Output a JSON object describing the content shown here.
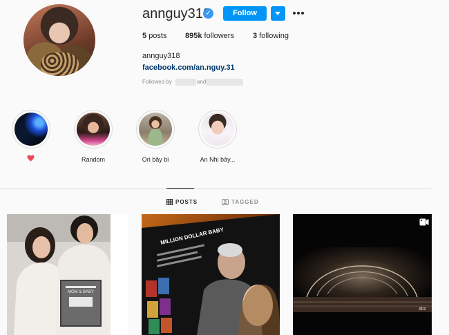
{
  "profile": {
    "username": "annguy318",
    "verified_icon": "verified-badge-icon",
    "follow_label": "Follow",
    "stats": {
      "posts_count": "5",
      "posts_label": "posts",
      "followers_count": "895k",
      "followers_label": "followers",
      "following_count": "3",
      "following_label": "following"
    },
    "bio_name": "annguy318",
    "bio_link": "facebook.com/an.nguy.31",
    "followed_by_label": "Followed by",
    "followed_by_and": "and"
  },
  "highlights": [
    {
      "label": "",
      "icon": "heart-icon"
    },
    {
      "label": "Random"
    },
    {
      "label": "Ori bây bi"
    },
    {
      "label": "An Nhi bây..."
    }
  ],
  "tabs": [
    {
      "label": "POSTS",
      "icon": "grid-icon",
      "active": true
    },
    {
      "label": "TAGGED",
      "icon": "tag-icon",
      "active": false
    }
  ],
  "posts": [
    {
      "sign_text": "MOM & BABY"
    },
    {
      "screen_title": "MILLION DOLLAR BABY"
    },
    {
      "badge": "video-icon",
      "watermark": "abc"
    }
  ],
  "colors": {
    "accent": "#0095f6",
    "verified": "#3897f0",
    "link": "#00376b",
    "heart": "#ed4956"
  }
}
